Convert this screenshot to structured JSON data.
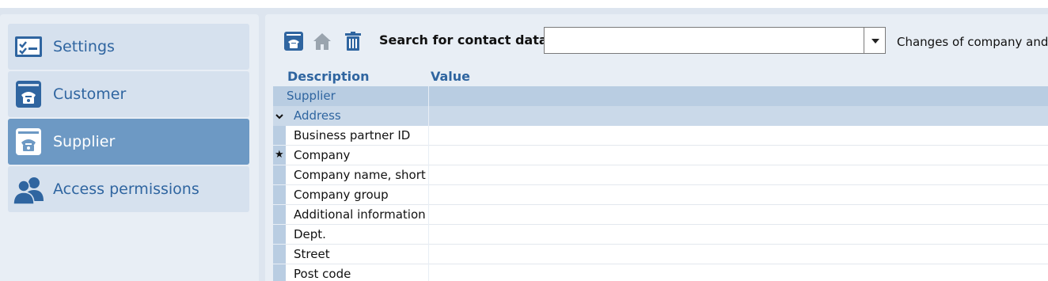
{
  "sidebar": {
    "items": [
      {
        "label": "Settings",
        "icon": "settings-checklist-icon",
        "active": false
      },
      {
        "label": "Customer",
        "icon": "phone-card-icon",
        "active": false
      },
      {
        "label": "Supplier",
        "icon": "phone-card-icon",
        "active": true
      },
      {
        "label": "Access permissions",
        "icon": "users-icon",
        "active": false
      }
    ]
  },
  "toolbar": {
    "buttons": [
      "phone-card-icon",
      "home-icon",
      "trash-icon"
    ],
    "search_label": "Search for contact data",
    "search_value": "",
    "changes_text": "Changes of company and"
  },
  "grid": {
    "headers": {
      "description": "Description",
      "value": "Value"
    },
    "group": "Supplier",
    "subgroup": "Address",
    "rows": [
      {
        "label": "Business partner ID",
        "value": "",
        "marked": false
      },
      {
        "label": "Company",
        "value": "",
        "marked": true
      },
      {
        "label": "Company name, short",
        "value": "",
        "marked": false
      },
      {
        "label": "Company group",
        "value": "",
        "marked": false
      },
      {
        "label": "Additional information",
        "value": "",
        "marked": false
      },
      {
        "label": "Dept.",
        "value": "",
        "marked": false
      },
      {
        "label": "Street",
        "value": "",
        "marked": false
      },
      {
        "label": "Post code",
        "value": "",
        "marked": false
      }
    ],
    "star_glyph": "★"
  },
  "colors": {
    "accent": "#2f65a0",
    "active_nav": "#6d99c4",
    "group_row": "#b9cde2",
    "subgroup_row": "#cad9e9"
  }
}
